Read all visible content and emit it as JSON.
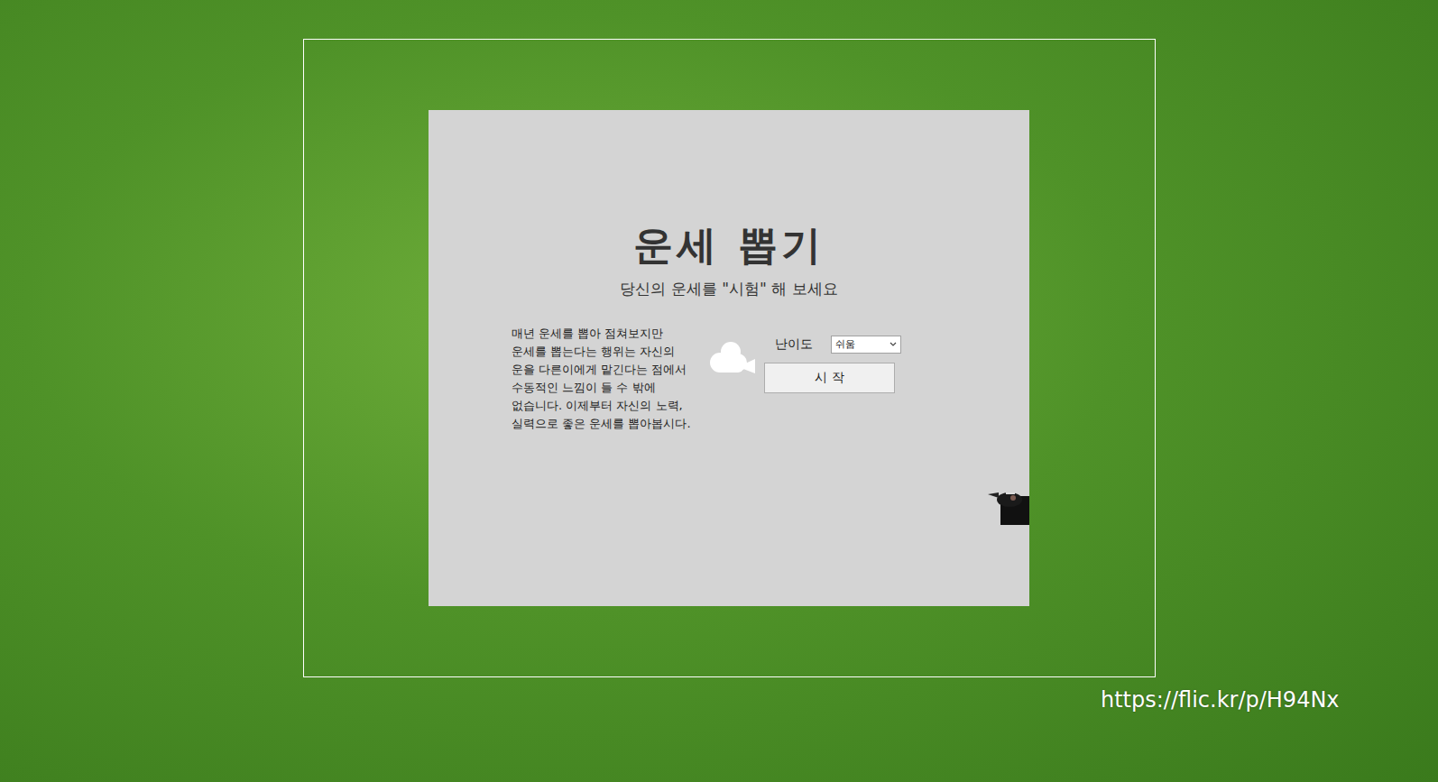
{
  "title": "운세 뽑기",
  "subtitle": "당신의 운세를 \"시험\" 해 보세요",
  "description": [
    "매년 운세를 뽑아 점쳐보지만",
    "운세를 뽑는다는 행위는 자신의",
    "운을 다른이에게  맡긴다는 점에서",
    "수동적인 느낌이 들 수 밖에",
    "없습니다. 이제부터 자신의 노력,",
    "실력으로 좋은 운세를 뽑아봅시다."
  ],
  "difficulty": {
    "label": "난이도",
    "value": "쉬움"
  },
  "buttons": [
    "시 작"
  ],
  "photo_credit": "https://flic.kr/p/H94Nx"
}
